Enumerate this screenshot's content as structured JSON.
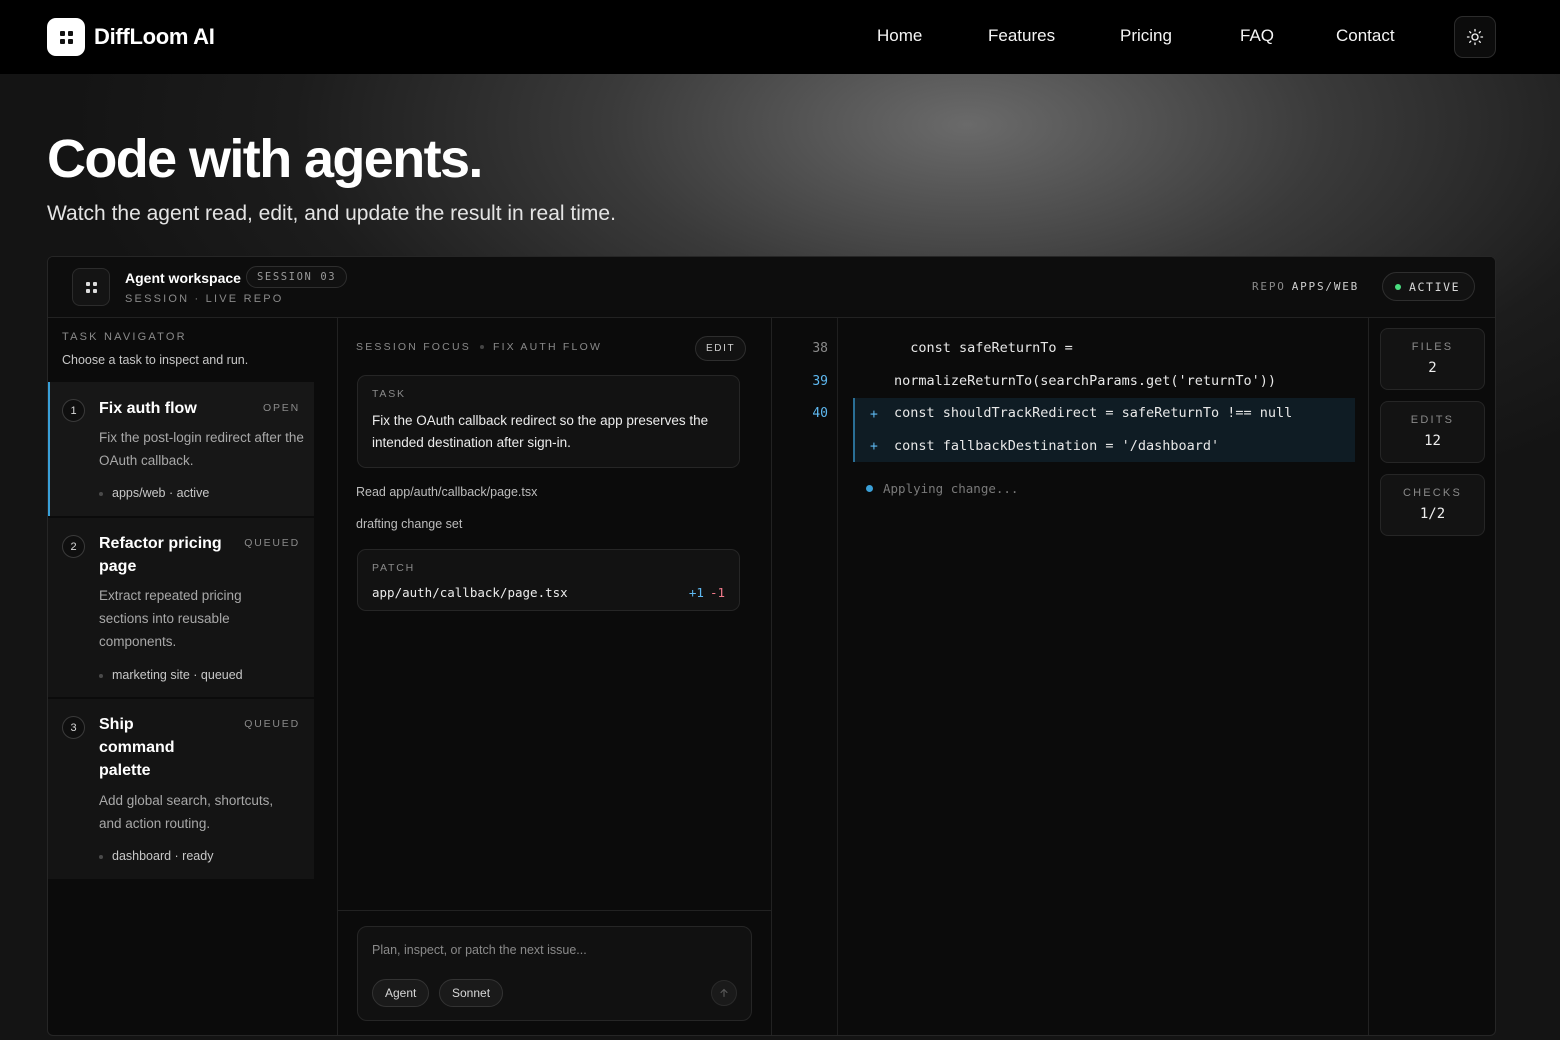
{
  "brand": {
    "name": "DiffLoom AI"
  },
  "nav": {
    "items": [
      "Home",
      "Features",
      "Pricing",
      "FAQ",
      "Contact"
    ]
  },
  "hero": {
    "title": "Code with agents.",
    "subtitle": "Watch the agent read, edit, and update the result in real time."
  },
  "workspace": {
    "title": "Agent workspace",
    "session_badge": "SESSION 03",
    "subtitle": "SESSION · LIVE REPO",
    "repo_label": "REPO",
    "repo_value": "APPS/WEB",
    "status": "ACTIVE"
  },
  "navigator": {
    "label": "TASK NAVIGATOR",
    "subtitle": "Choose a task to inspect and run.",
    "tasks": [
      {
        "num": "1",
        "title": "Fix auth flow",
        "status": "OPEN",
        "desc": "Fix the post-login redirect after the OAuth callback.",
        "meta": "apps/web · active"
      },
      {
        "num": "2",
        "title": "Refactor pricing page",
        "status": "QUEUED",
        "desc": "Extract repeated pricing sections into reusable components.",
        "meta": "marketing site · queued"
      },
      {
        "num": "3",
        "title": "Ship command palette",
        "status": "QUEUED",
        "desc": "Add global search, shortcuts, and action routing.",
        "meta": "dashboard · ready"
      }
    ]
  },
  "focus": {
    "label": "SESSION FOCUS",
    "task_name": "FIX AUTH FLOW",
    "edit_label": "EDIT",
    "task_card_label": "TASK",
    "task_card_text": "Fix the OAuth callback redirect so the app preserves the intended destination after sign-in.",
    "log": [
      "Read app/auth/callback/page.tsx",
      "drafting change set"
    ],
    "patch_label": "PATCH",
    "patch_file": "app/auth/callback/page.tsx",
    "patch_added": "+1",
    "patch_removed": "-1"
  },
  "composer": {
    "placeholder": "Plan, inspect, or patch the next issue...",
    "chips": [
      "Agent",
      "Sonnet"
    ]
  },
  "code": {
    "line_numbers": [
      "38",
      "39",
      "40"
    ],
    "lines": [
      "  const safeReturnTo =",
      "normalizeReturnTo(searchParams.get('returnTo'))",
      "const shouldTrackRedirect = safeReturnTo !== null",
      "const fallbackDestination = '/dashboard'"
    ],
    "diff_marker": "+",
    "status": "Applying change..."
  },
  "stats": [
    {
      "label": "FILES",
      "value": "2"
    },
    {
      "label": "EDITS",
      "value": "12"
    },
    {
      "label": "CHECKS",
      "value": "1/2"
    }
  ],
  "colors": {
    "accent": "#3aa0d8",
    "active": "#4ade80",
    "removed": "#f07a8a"
  }
}
